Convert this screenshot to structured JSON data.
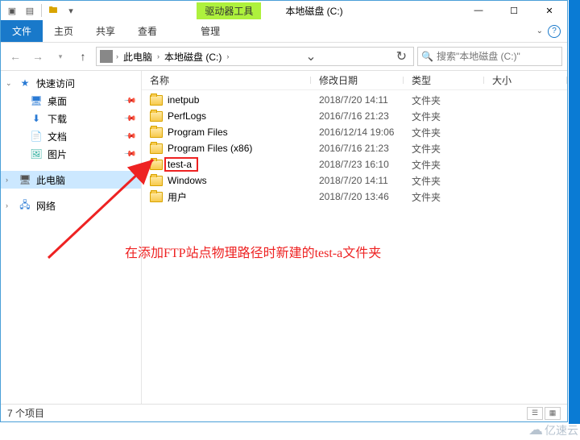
{
  "titlebar": {
    "context_label": "驱动器工具",
    "title": "本地磁盘 (C:)"
  },
  "win_controls": {
    "min": "—",
    "max": "☐",
    "close": "✕"
  },
  "ribbon": {
    "file": "文件",
    "tabs": [
      "主页",
      "共享",
      "查看"
    ],
    "context_tab": "管理"
  },
  "address": {
    "segments": [
      "此电脑",
      "本地磁盘 (C:)"
    ]
  },
  "search": {
    "placeholder": "搜索\"本地磁盘 (C:)\""
  },
  "sidebar": {
    "quick": "快速访问",
    "items": [
      {
        "icon": "🖥",
        "label": "桌面",
        "pinned": true
      },
      {
        "icon": "⬇",
        "label": "下载",
        "pinned": true
      },
      {
        "icon": "📄",
        "label": "文档",
        "pinned": true
      },
      {
        "icon": "🖼",
        "label": "图片",
        "pinned": true
      }
    ],
    "thispc": "此电脑",
    "network": "网络"
  },
  "columns": {
    "name": "名称",
    "date": "修改日期",
    "type": "类型",
    "size": "大小"
  },
  "type_folder": "文件夹",
  "files": [
    {
      "name": "inetpub",
      "date": "2018/7/20 14:11"
    },
    {
      "name": "PerfLogs",
      "date": "2016/7/16 21:23"
    },
    {
      "name": "Program Files",
      "date": "2016/12/14 19:06"
    },
    {
      "name": "Program Files (x86)",
      "date": "2016/7/16 21:23"
    },
    {
      "name": "test-a",
      "date": "2018/7/23 16:10",
      "highlight": true
    },
    {
      "name": "Windows",
      "date": "2018/7/20 14:11"
    },
    {
      "name": "用户",
      "date": "2018/7/20 13:46"
    }
  ],
  "status": {
    "count": "7 个项目"
  },
  "annotation": "在添加FTP站点物理路径时新建的test-a文件夹",
  "watermark": "亿速云"
}
